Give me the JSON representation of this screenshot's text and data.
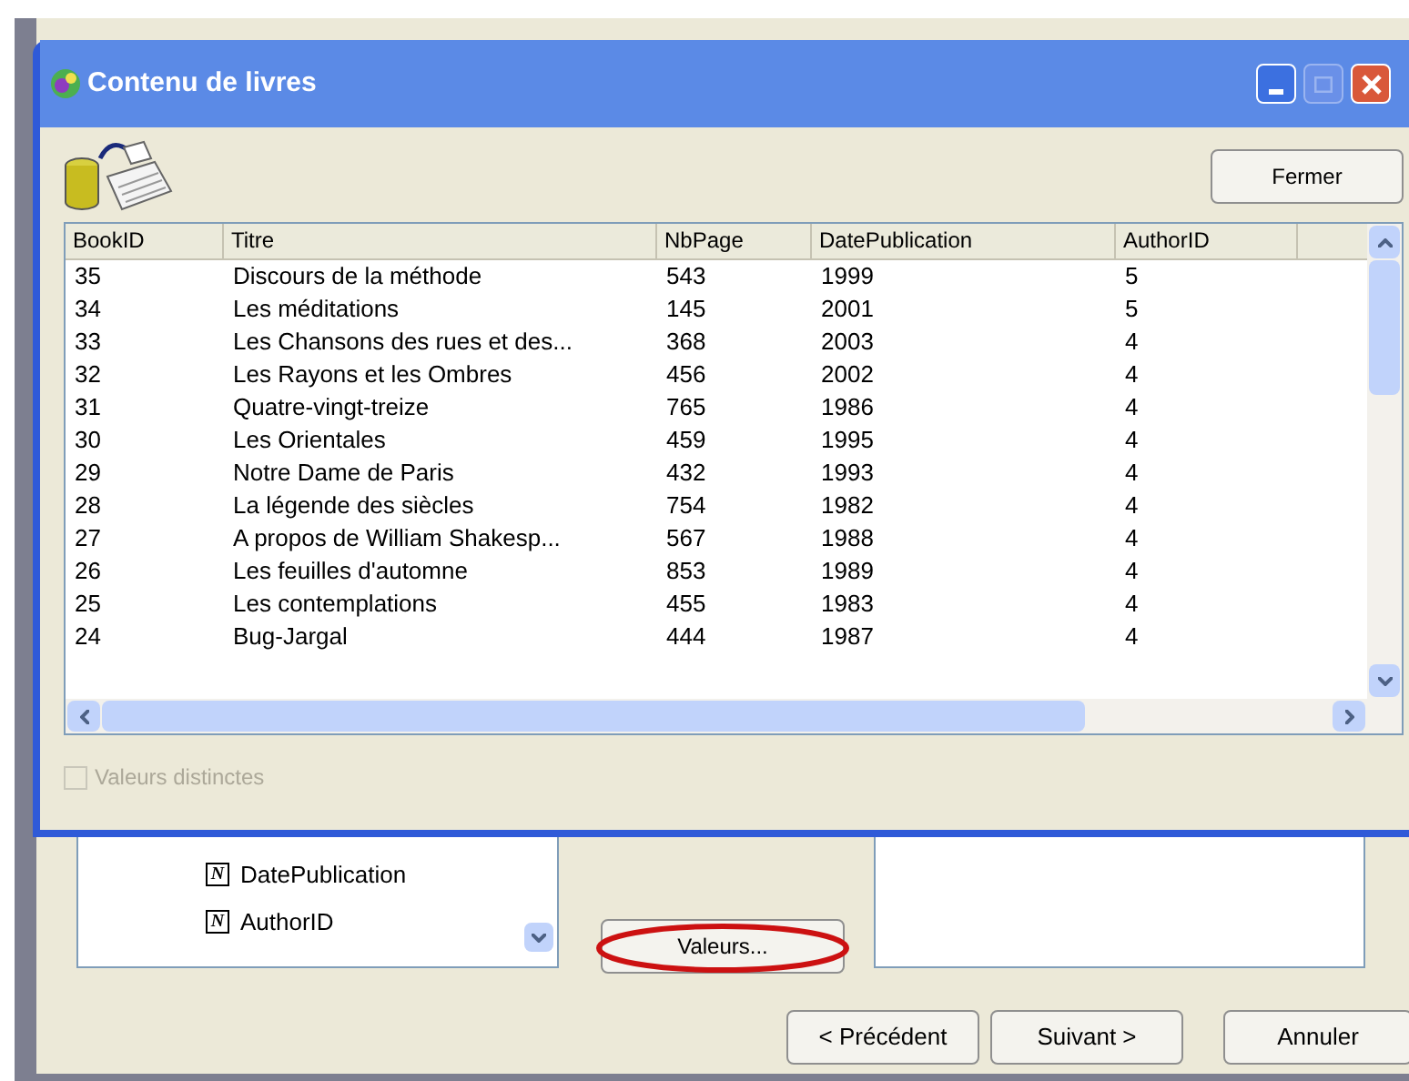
{
  "window": {
    "title": "Contenu de livres"
  },
  "toolbar": {
    "close_button": "Fermer"
  },
  "table": {
    "columns": [
      "BookID",
      "Titre",
      "NbPage",
      "DatePublication",
      "AuthorID"
    ],
    "rows": [
      [
        "35",
        "Discours de la méthode",
        "543",
        "1999",
        "5"
      ],
      [
        "34",
        "Les méditations",
        "145",
        "2001",
        "5"
      ],
      [
        "33",
        "Les Chansons des rues et des...",
        "368",
        "2003",
        "4"
      ],
      [
        "32",
        "Les Rayons et les Ombres",
        "456",
        "2002",
        "4"
      ],
      [
        "31",
        "Quatre-vingt-treize",
        "765",
        "1986",
        "4"
      ],
      [
        "30",
        "Les Orientales",
        "459",
        "1995",
        "4"
      ],
      [
        "29",
        "Notre Dame de Paris",
        "432",
        "1993",
        "4"
      ],
      [
        "28",
        "La légende des siècles",
        "754",
        "1982",
        "4"
      ],
      [
        "27",
        "A propos de William Shakesp...",
        "567",
        "1988",
        "4"
      ],
      [
        "26",
        "Les feuilles d'automne",
        "853",
        "1989",
        "4"
      ],
      [
        "25",
        "Les contemplations",
        "455",
        "1983",
        "4"
      ],
      [
        "24",
        "Bug-Jargal",
        "444",
        "1987",
        "4"
      ]
    ]
  },
  "distinct_values": {
    "label": "Valeurs distinctes",
    "checked": false,
    "disabled": true
  },
  "background_dialog": {
    "fields": [
      {
        "type_letter": "N",
        "label": "DatePublication"
      },
      {
        "type_letter": "N",
        "label": "AuthorID"
      }
    ],
    "values_button": "Valeurs...",
    "buttons": [
      "< Précédent",
      "Suivant >",
      "Annuler"
    ]
  }
}
